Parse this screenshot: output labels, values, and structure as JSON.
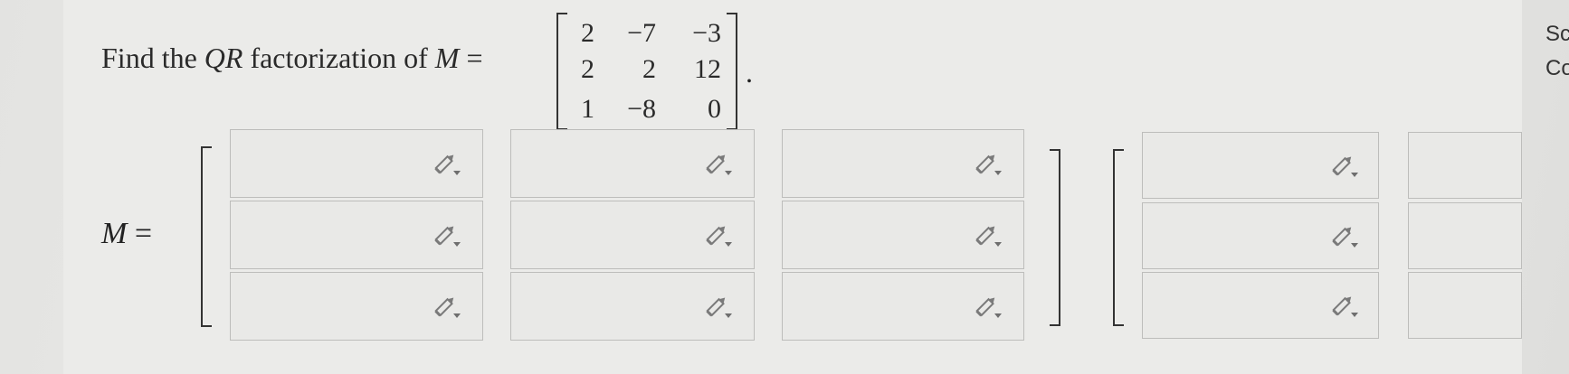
{
  "question": {
    "prefix": "Find the ",
    "qr": "QR",
    "middle": " factorization of ",
    "m_var": "M",
    "equals": " =",
    "period": "."
  },
  "matrix": [
    [
      "2",
      "−7",
      "−3"
    ],
    [
      "2",
      "2",
      "12"
    ],
    [
      "1",
      "−8",
      "0"
    ]
  ],
  "answer_label": {
    "m_var": "M",
    "equals": " ="
  },
  "q_matrix": {
    "rows": 3,
    "cols": 3,
    "values": [
      "",
      "",
      "",
      "",
      "",
      "",
      "",
      "",
      ""
    ]
  },
  "r_matrix": {
    "rows": 3,
    "cols": 2,
    "values": [
      "",
      "",
      "",
      "",
      "",
      ""
    ]
  },
  "side_panel": {
    "line1": "Sc",
    "line2": "Co"
  },
  "icons": {
    "input_tool": "pencil-dropdown-icon"
  }
}
